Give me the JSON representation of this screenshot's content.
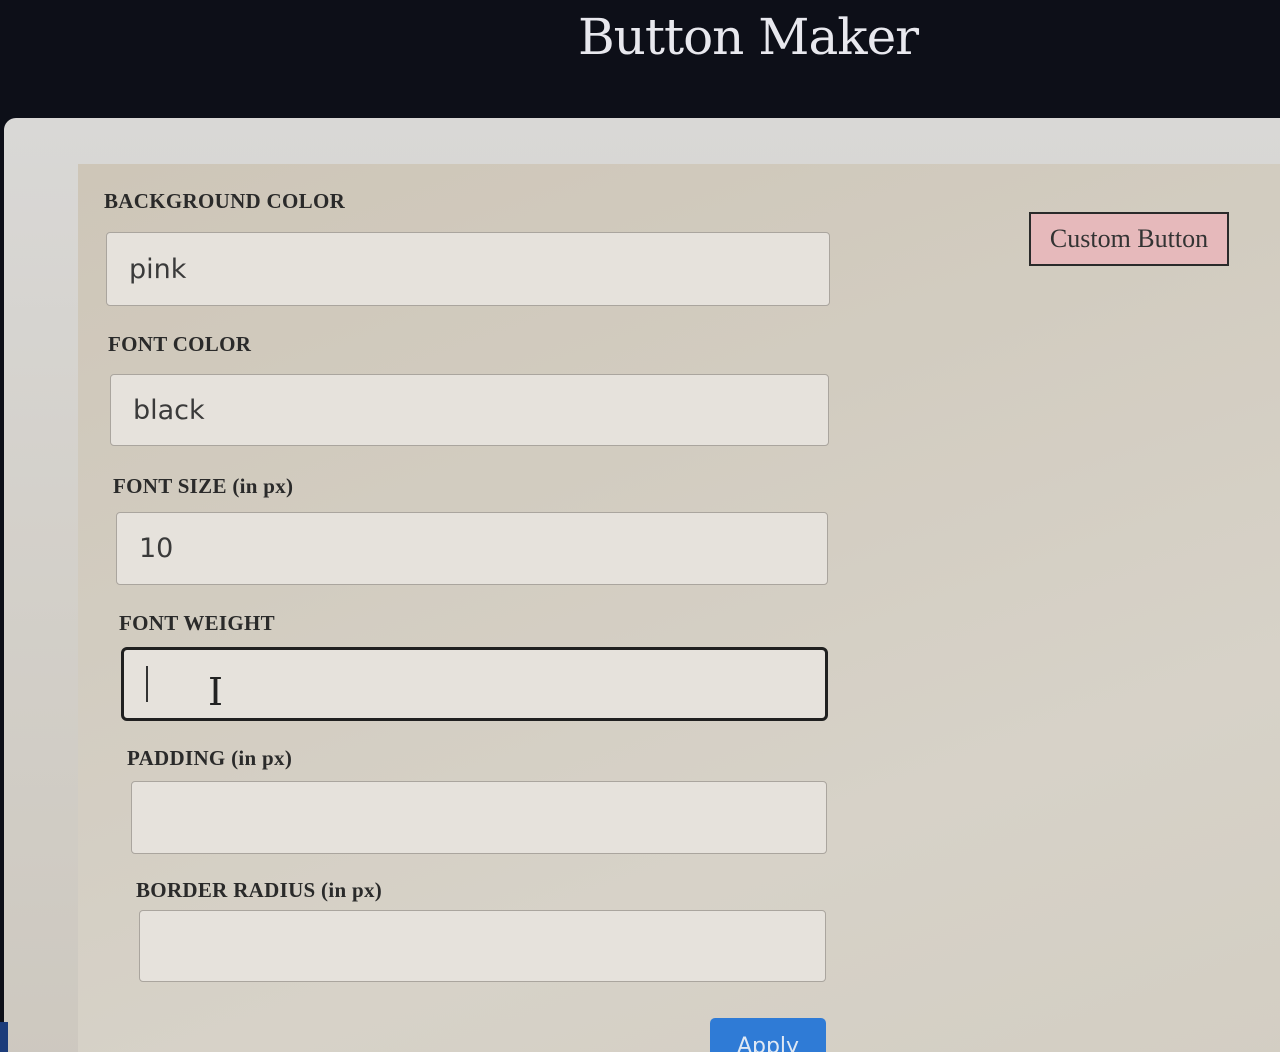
{
  "app": {
    "title": "Button Maker"
  },
  "form": {
    "background_color": {
      "label": "BACKGROUND COLOR",
      "value": "pink"
    },
    "font_color": {
      "label": "FONT COLOR",
      "value": "black"
    },
    "font_size": {
      "label": "FONT SIZE (in px)",
      "value": "10"
    },
    "font_weight": {
      "label": "FONT WEIGHT",
      "value": ""
    },
    "padding": {
      "label": "PADDING (in px)",
      "value": ""
    },
    "border_radius": {
      "label": "BORDER RADIUS (in px)",
      "value": ""
    },
    "apply_label": "Apply"
  },
  "preview": {
    "button_label": "Custom Button",
    "background": "#e6b9bb",
    "text_color": "#333333"
  },
  "colors": {
    "header_bg": "#0d0f18",
    "panel_bg": "#d2ccc0",
    "apply_accent": "#2f7bd6"
  },
  "icons": {
    "text_cursor": "i-beam-cursor-icon"
  }
}
